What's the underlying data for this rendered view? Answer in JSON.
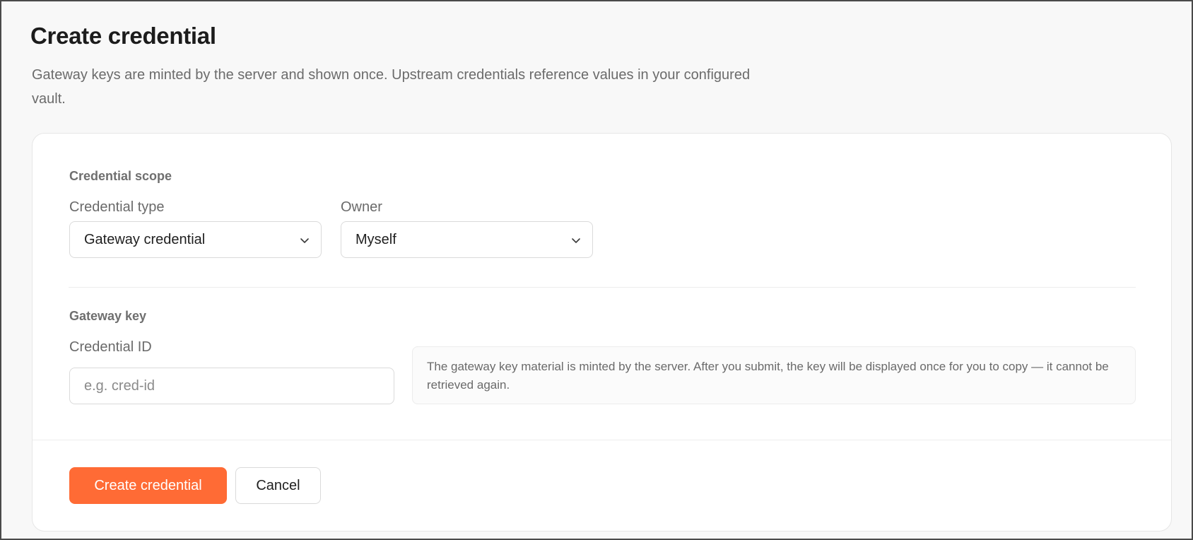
{
  "page": {
    "title": "Create credential",
    "description": "Gateway keys are minted by the server and shown once. Upstream credentials reference values in your configured vault."
  },
  "scope_section": {
    "heading": "Credential scope",
    "credential_type": {
      "label": "Credential type",
      "value": "Gateway credential"
    },
    "owner": {
      "label": "Owner",
      "value": "Myself"
    }
  },
  "key_section": {
    "heading": "Gateway key",
    "credential_id": {
      "label": "Credential ID",
      "value": "",
      "placeholder": "e.g. cred-id"
    },
    "info_text": "The gateway key material is minted by the server. After you submit, the key will be displayed once for you to copy — it cannot be retrieved again."
  },
  "actions": {
    "submit_label": "Create credential",
    "cancel_label": "Cancel"
  },
  "icons": {
    "dropdown": "chevron-down-icon"
  },
  "colors": {
    "accent": "#ff6b35",
    "text_primary": "#1c1c1c",
    "text_secondary": "#6b6b6b",
    "border": "#dadada",
    "background": "#f8f8f8",
    "card": "#ffffff"
  }
}
